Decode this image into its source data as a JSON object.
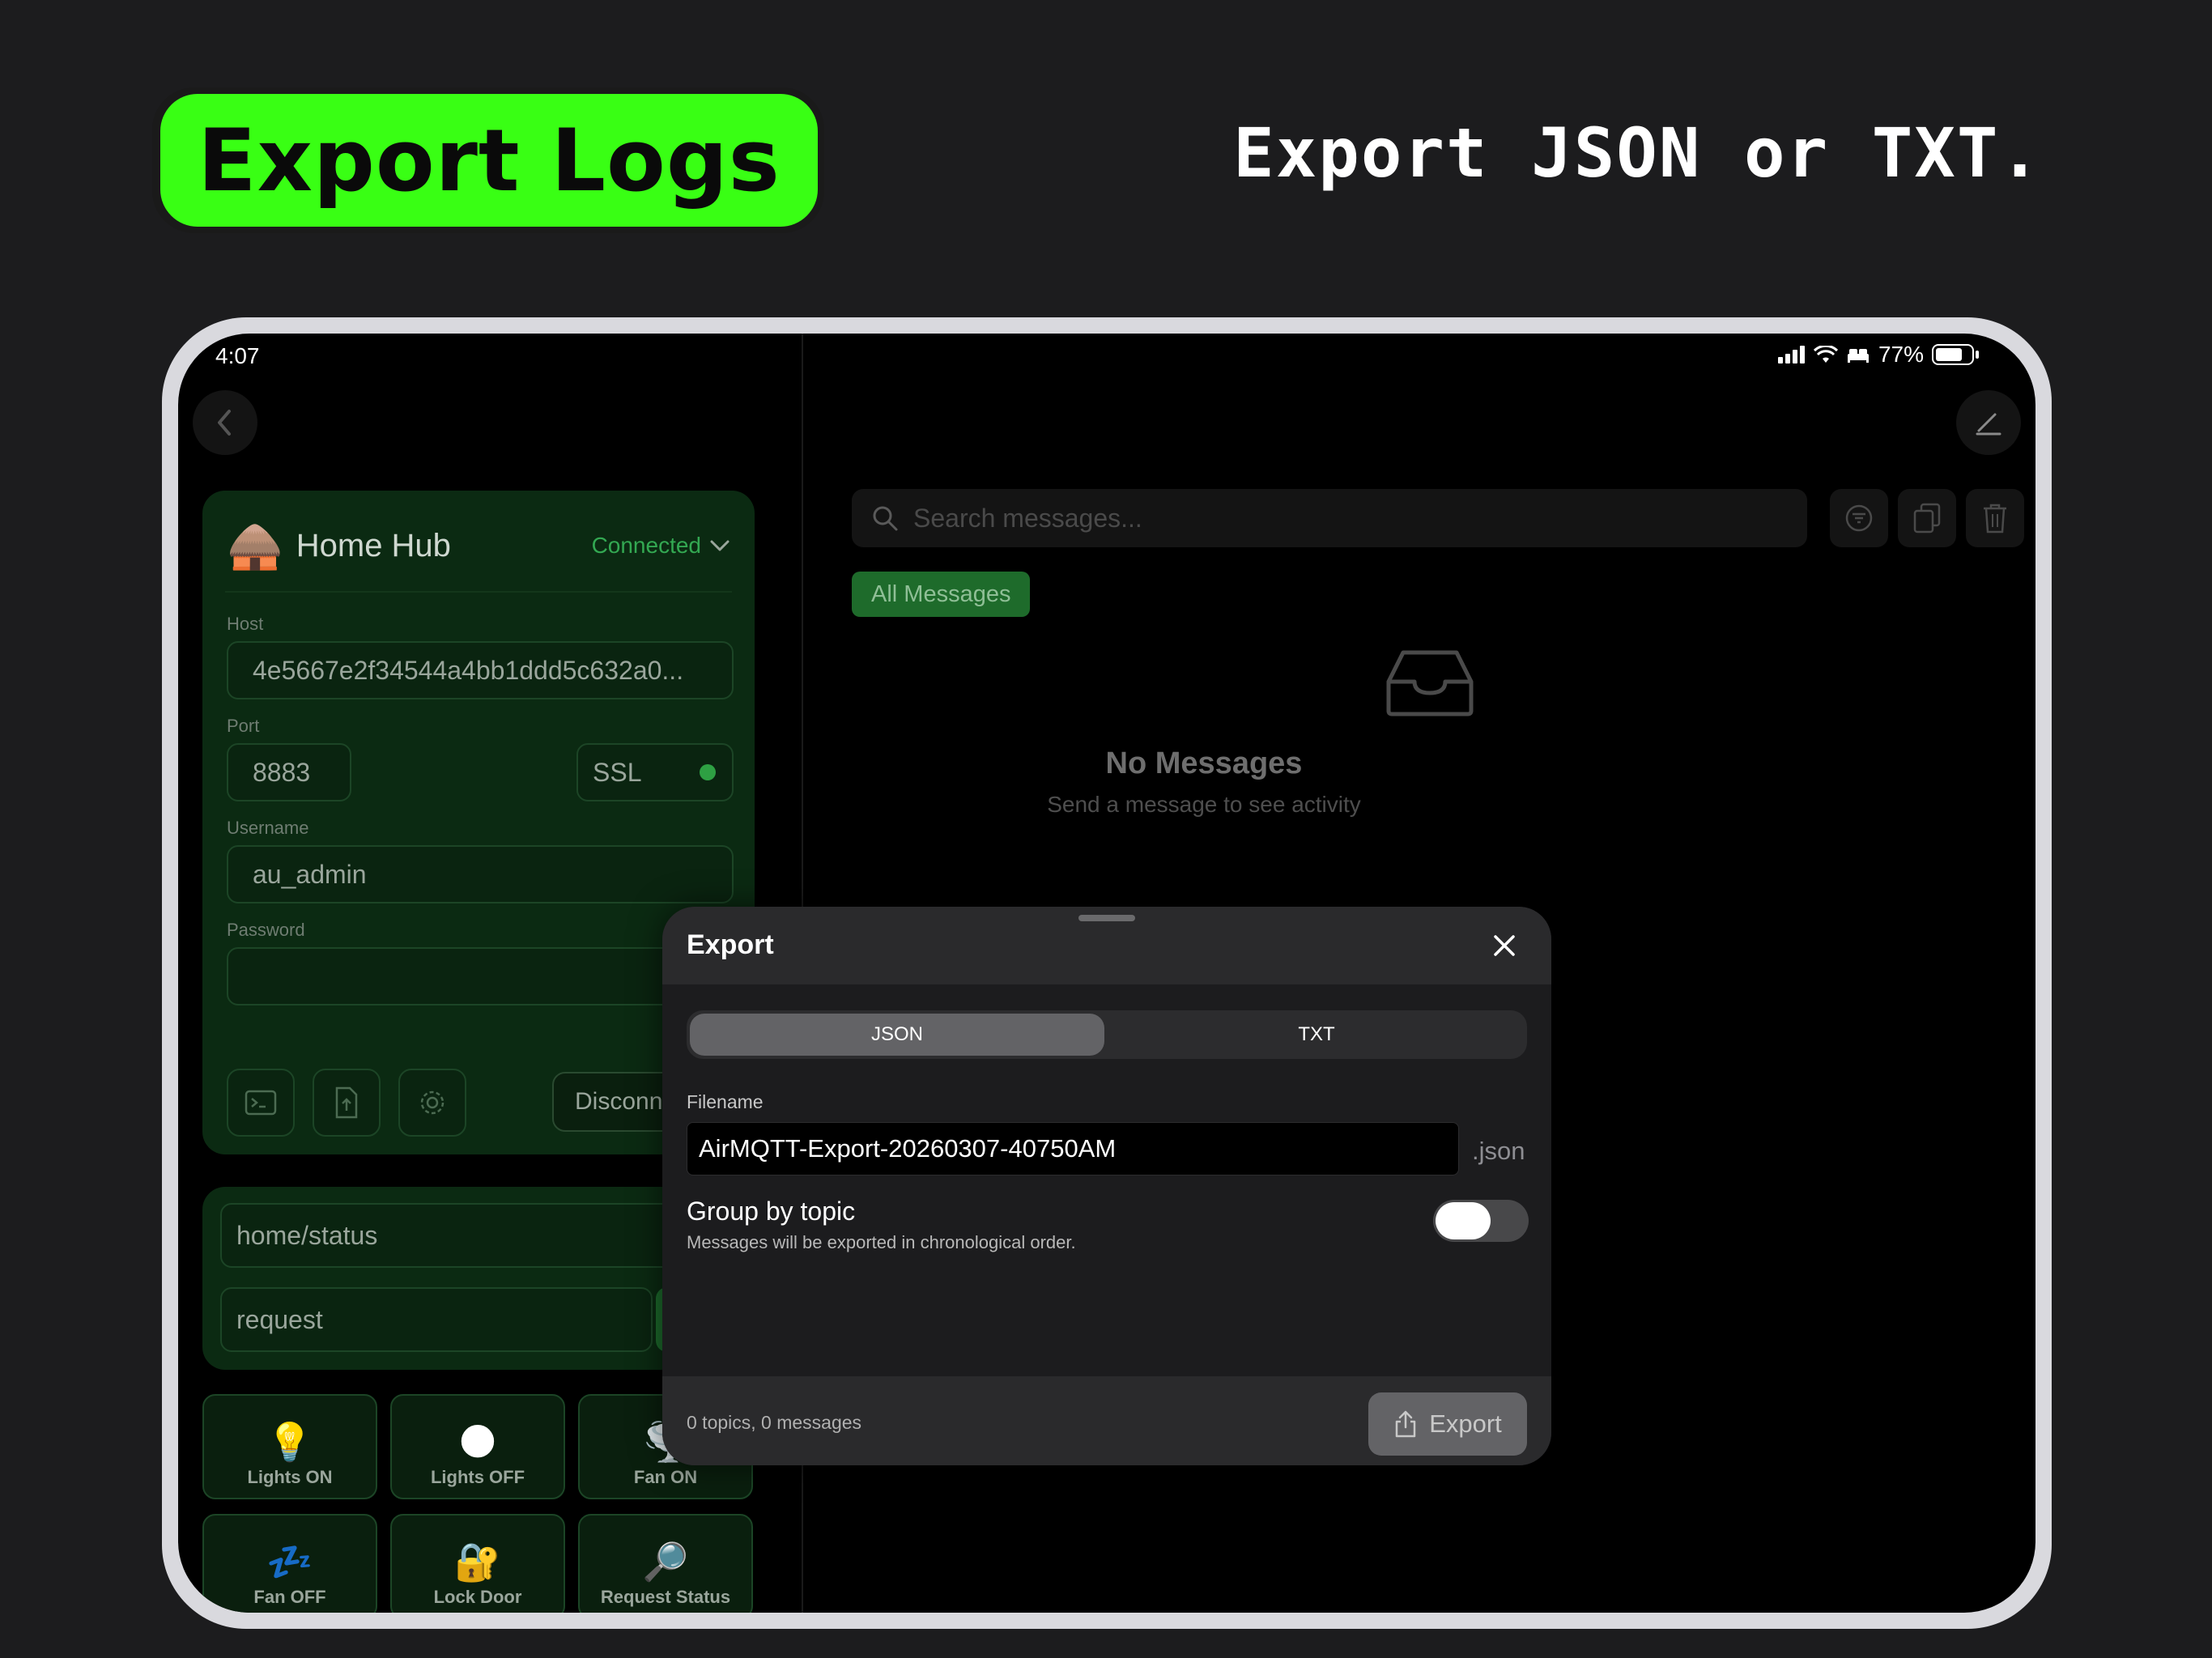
{
  "hero": {
    "title": "Export Logs",
    "subtitle": "Export JSON or TXT."
  },
  "status_bar": {
    "time": "4:07",
    "battery": "77%",
    "battery_level": 0.77
  },
  "sidebar": {
    "broker_emoji": "🛖",
    "broker_name": "Home Hub",
    "connection_status": "Connected",
    "host_label": "Host",
    "host_value": "4e5667e2f34544a4bb1ddd5c632a0...",
    "port_label": "Port",
    "port_value": "8883",
    "ssl_label": "SSL",
    "username_label": "Username",
    "username_value": "au_admin",
    "password_label": "Password",
    "password_value": "",
    "disconnect_label": "Disconnect",
    "publish_topic": "home/status",
    "publish_payload": "request",
    "quick_actions": [
      {
        "emoji": "💡",
        "label": "Lights ON"
      },
      {
        "emoji": "🌑",
        "label": "Lights OFF"
      },
      {
        "emoji": "🌪️",
        "label": "Fan ON"
      },
      {
        "emoji": "💤",
        "label": "Fan OFF"
      },
      {
        "emoji": "🔐",
        "label": "Lock Door"
      },
      {
        "emoji": "🔎",
        "label": "Request Status"
      }
    ]
  },
  "messages": {
    "search_placeholder": "Search messages...",
    "filter_chip": "All Messages",
    "empty_title": "No Messages",
    "empty_subtitle": "Send a message to see activity"
  },
  "export_sheet": {
    "title": "Export",
    "formats": [
      "JSON",
      "TXT"
    ],
    "selected_format": "JSON",
    "filename_label": "Filename",
    "filename_value": "AirMQTT-Export-20260307-40750AM",
    "filename_extension": ".json",
    "group_title": "Group by topic",
    "group_subtitle": "Messages will be exported in chronological order.",
    "group_enabled": false,
    "summary": "0 topics, 0 messages",
    "export_label": "Export"
  },
  "colors": {
    "accent_green": "#39ff14",
    "connected_green": "#33a852",
    "card_green": "#0b2a12"
  }
}
